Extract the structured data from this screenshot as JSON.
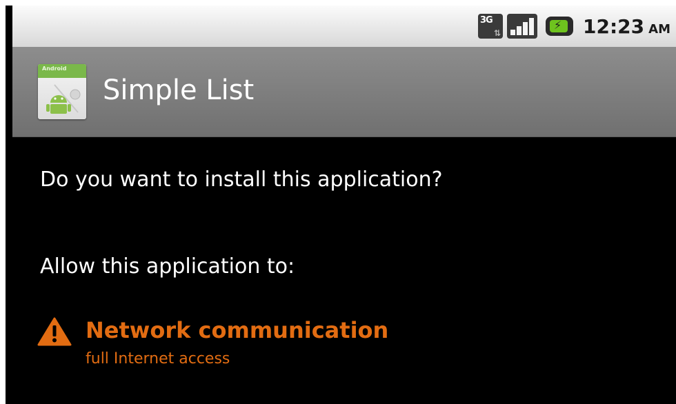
{
  "status_bar": {
    "network_label": "3G",
    "time": "12:23",
    "ampm": "AM",
    "icons": [
      "3g-network-icon",
      "signal-strength-icon",
      "battery-charging-icon"
    ]
  },
  "title_bar": {
    "app_icon": "android-app-icon",
    "app_icon_label": "Android",
    "title": "Simple List"
  },
  "install": {
    "question": "Do you want to install this application?",
    "allow_heading": "Allow this application to:",
    "permissions": [
      {
        "icon": "warning-icon",
        "name": "Network communication",
        "description": "full Internet access"
      }
    ]
  },
  "colors": {
    "permission_accent": "#e26c12",
    "title_bar": "#7d7d7d",
    "background": "#000000",
    "battery": "#6ec31e"
  }
}
